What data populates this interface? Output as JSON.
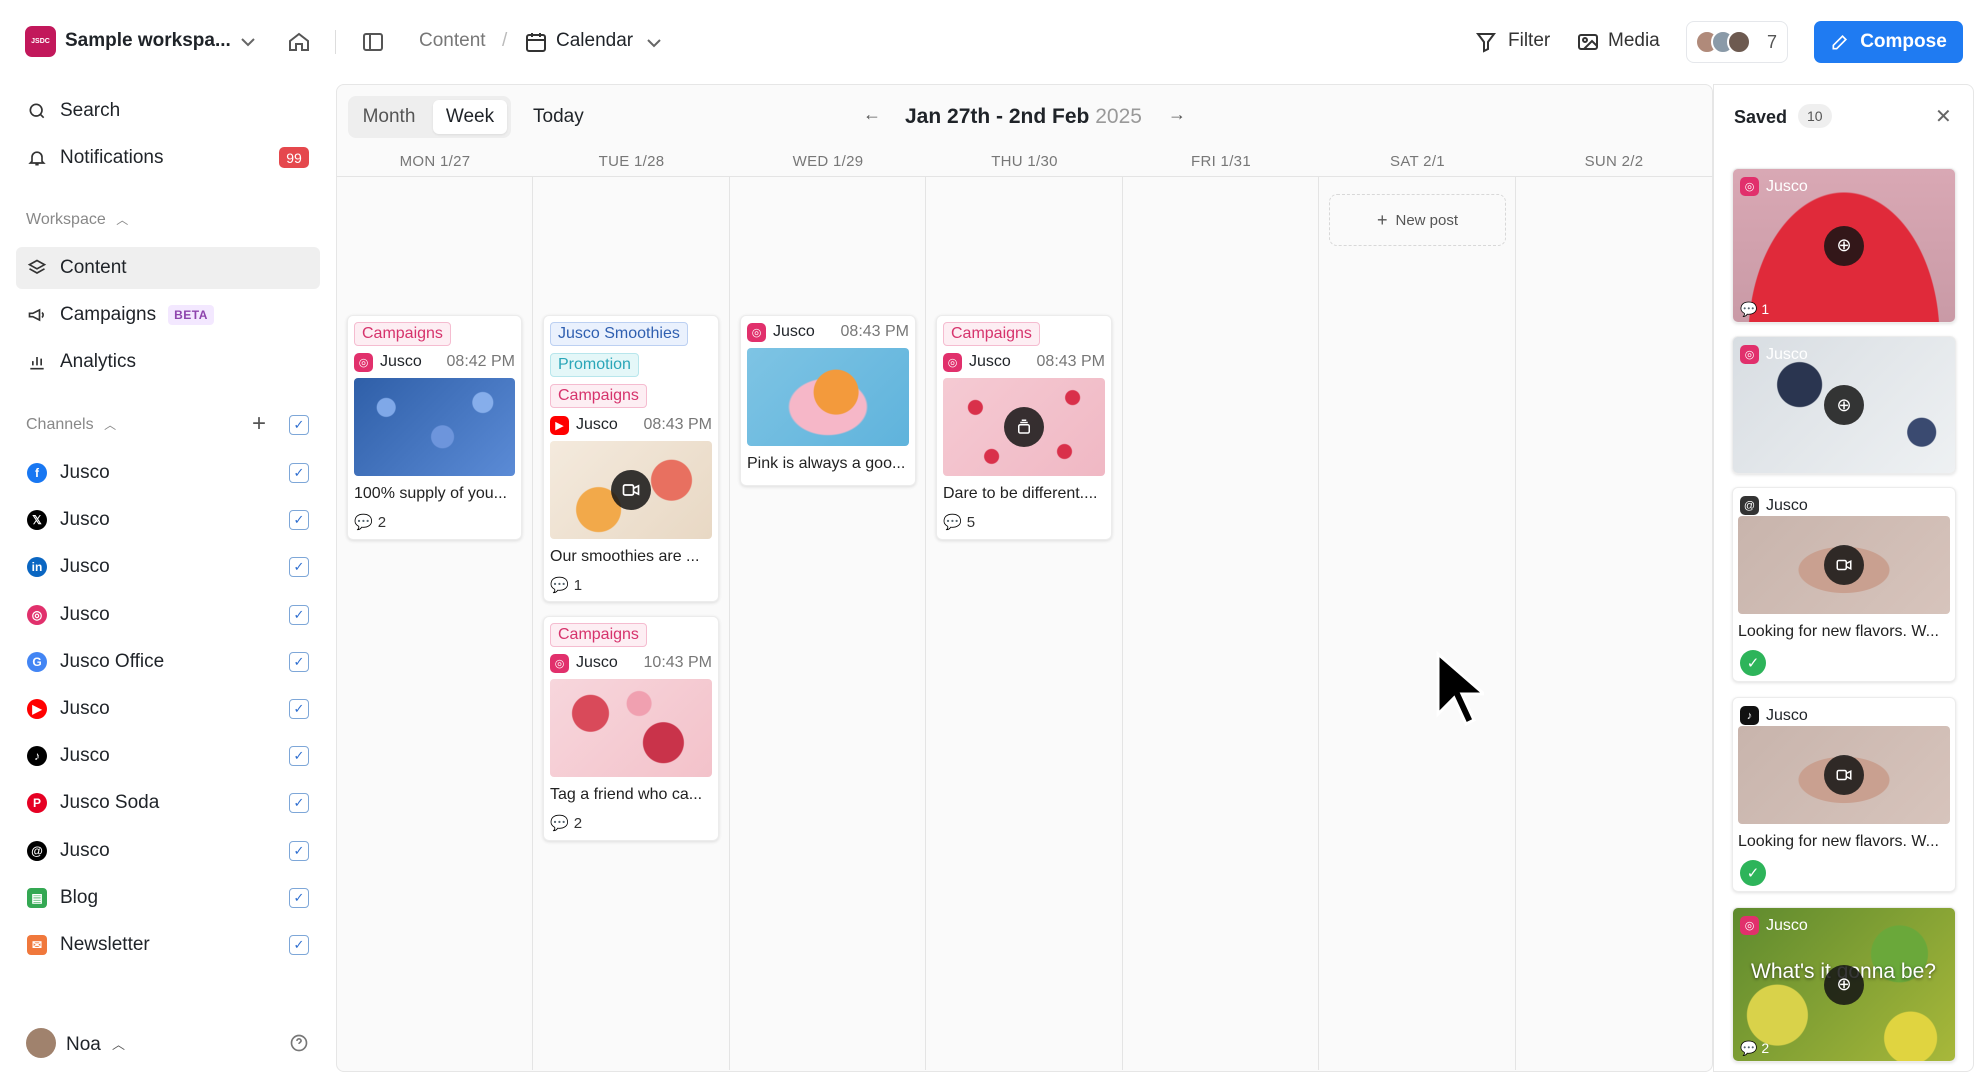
{
  "header": {
    "workspace_logo": "JSDC",
    "workspace_name": "Sample workspa...",
    "breadcrumb_root": "Content",
    "breadcrumb_sep": "/",
    "breadcrumb_current": "Calendar",
    "filter_label": "Filter",
    "media_label": "Media",
    "member_count": "7",
    "compose_label": "Compose"
  },
  "sidebar": {
    "search_label": "Search",
    "notifications_label": "Notifications",
    "notifications_count": "99",
    "workspace_section": "Workspace",
    "content_label": "Content",
    "campaigns_label": "Campaigns",
    "campaigns_badge": "BETA",
    "analytics_label": "Analytics",
    "channels_section": "Channels",
    "channels": [
      {
        "name": "Jusco",
        "network": "facebook",
        "color": "#1877f2"
      },
      {
        "name": "Jusco",
        "network": "x",
        "color": "#000000"
      },
      {
        "name": "Jusco",
        "network": "linkedin",
        "color": "#0a66c2"
      },
      {
        "name": "Jusco",
        "network": "instagram",
        "color": "#e1306c"
      },
      {
        "name": "Jusco Office",
        "network": "google",
        "color": "#4285f4"
      },
      {
        "name": "Jusco",
        "network": "youtube",
        "color": "#ff0000"
      },
      {
        "name": "Jusco",
        "network": "tiktok",
        "color": "#000000"
      },
      {
        "name": "Jusco Soda",
        "network": "pinterest",
        "color": "#e60023"
      },
      {
        "name": "Jusco",
        "network": "threads",
        "color": "#000000"
      },
      {
        "name": "Blog",
        "network": "blog",
        "color": "#34a853"
      },
      {
        "name": "Newsletter",
        "network": "newsletter",
        "color": "#f0783c"
      }
    ],
    "user_name": "Noa"
  },
  "calendar": {
    "view_month": "Month",
    "view_week": "Week",
    "today_label": "Today",
    "range_main": "Jan 27th - 2nd Feb",
    "range_year": "2025",
    "days": [
      "MON 1/27",
      "TUE 1/28",
      "WED 1/29",
      "THU 1/30",
      "FRI 1/31",
      "SAT 2/1",
      "SUN 2/2"
    ],
    "new_post_label": "New post",
    "posts": {
      "mon": {
        "tag": "Campaigns",
        "account": "Jusco",
        "time": "08:42 PM",
        "caption": "100% supply of you...",
        "comments": "2"
      },
      "tue1": {
        "tags": [
          "Jusco Smoothies",
          "Promotion",
          "Campaigns"
        ],
        "account": "Jusco",
        "time": "08:43 PM",
        "caption": "Our smoothies are ...",
        "comments": "1"
      },
      "tue2": {
        "tag": "Campaigns",
        "account": "Jusco",
        "time": "10:43 PM",
        "caption": "Tag a friend who ca...",
        "comments": "2"
      },
      "wed": {
        "account": "Jusco",
        "time": "08:43 PM",
        "caption": "Pink is always a goo..."
      },
      "thu": {
        "tag": "Campaigns",
        "account": "Jusco",
        "time": "08:43 PM",
        "caption": "Dare to be different....",
        "comments": "5"
      }
    }
  },
  "saved": {
    "title": "Saved",
    "count": "10",
    "items": [
      {
        "account": "Jusco",
        "comments": "1"
      },
      {
        "account": "Jusco"
      },
      {
        "account": "Jusco",
        "caption": "Looking for new flavors. W..."
      },
      {
        "account": "Jusco",
        "caption": "Looking for new flavors. W..."
      },
      {
        "account": "Jusco",
        "overlay_text": "What's it gonna be?",
        "comments": "2"
      }
    ]
  }
}
